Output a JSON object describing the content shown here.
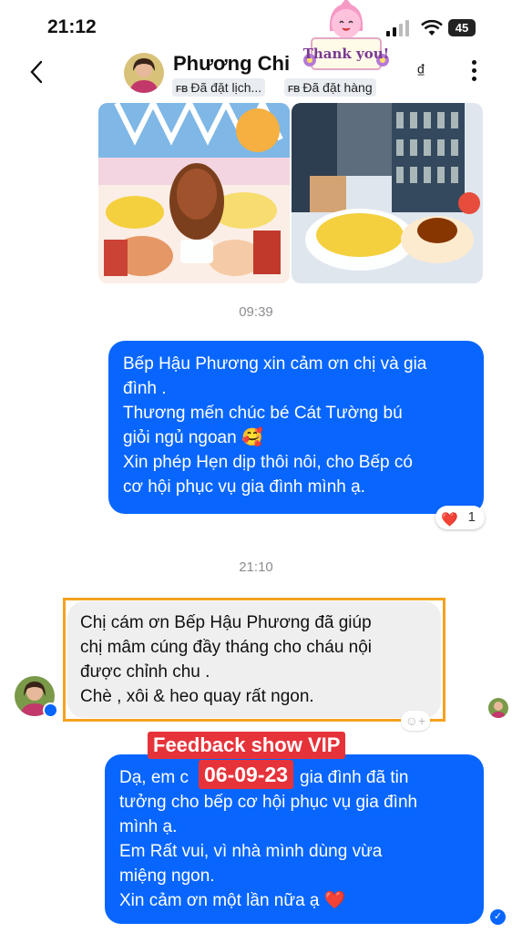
{
  "status_bar": {
    "time": "21:12",
    "battery": "45"
  },
  "header": {
    "contact_name": "Phương Chi",
    "chips": [
      {
        "prefix": "FB",
        "text": "Đã đặt lịch..."
      },
      {
        "prefix": "FB",
        "text": "Đã đặt hàng"
      }
    ],
    "currency_symbol": "₫",
    "sticker_text": "Thank you!"
  },
  "messages": {
    "time1": "09:39",
    "outgoing1_lines": [
      "Bếp Hậu Phương xin cảm ơn chị và gia",
      "đình .",
      "Thương mến chúc bé Cát Tường bú",
      "giỏi ngủ ngoan 🥰",
      "Xin phép Hẹn dịp thôi nôi, cho Bếp có",
      "cơ hội phục vụ gia đình mình ạ."
    ],
    "reaction_emoji": "❤️",
    "reaction_count": "1",
    "time2": "21:10",
    "incoming_lines": [
      "Chị cám ơn Bếp Hậu Phương đã giúp",
      "chị mâm cúng đầy tháng cho cháu nội",
      "được chỉnh chu .",
      "Chè , xôi & heo quay rất ngon."
    ],
    "outgoing2_lines": [
      "Dạ, em c",
      "gia đình đã tin",
      "tưởng cho bếp cơ hội phục vụ gia đình",
      "mình ạ.",
      "Em Rất vui,  vì nhà mình dùng vừa",
      "miệng ngon.",
      "Xin cảm ơn một lần nữa ạ ❤️"
    ]
  },
  "overlay": {
    "title": "Feedback show VIP",
    "date": "06-09-23"
  },
  "colors": {
    "accent": "#0866ff",
    "frame": "#f5a21e",
    "overlay": "#e6333a"
  }
}
